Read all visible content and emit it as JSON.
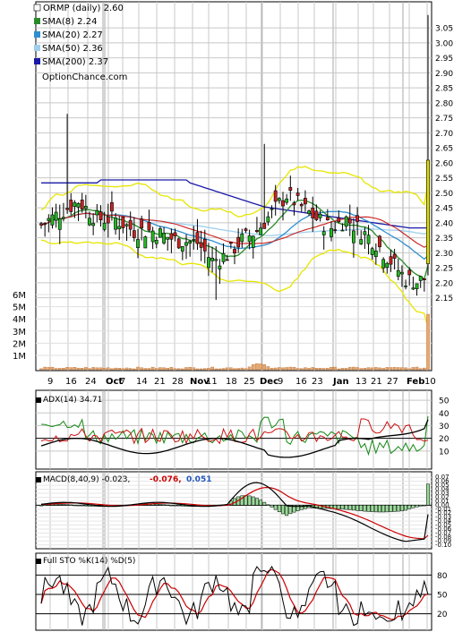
{
  "chart_data": [
    {
      "type": "candlestick",
      "panel": "price",
      "title": "ORMP (daily) 2.60",
      "watermark": "OptionChance.com",
      "legend_placement": "top-left",
      "legend": [
        {
          "label": "SMA(8) 2.24",
          "color": "#2a8a2a"
        },
        {
          "label": "SMA(20) 2.27",
          "color": "#2f8fd0"
        },
        {
          "label": "SMA(50) 2.36",
          "color": "#9fd0ee"
        },
        {
          "label": "SMA(200) 2.37",
          "color": "#1a1aa8"
        }
      ],
      "ylim": [
        2.1,
        3.1
      ],
      "y_ticks": [
        "3.05",
        "3.00",
        "2.95",
        "2.90",
        "2.85",
        "2.80",
        "2.75",
        "2.70",
        "2.65",
        "2.60",
        "2.55",
        "2.50",
        "2.45",
        "2.40",
        "2.35",
        "2.30",
        "2.25",
        "2.20",
        "2.15"
      ],
      "x_ticks": [
        "9",
        "16",
        "24",
        "Oct",
        "7",
        "14",
        "21",
        "28",
        "Nov",
        "11",
        "18",
        "25",
        "Dec",
        "9",
        "16",
        "23",
        "Jan",
        "13",
        "21",
        "27",
        "Feb",
        "10"
      ],
      "grid": true,
      "colors": {
        "up": "#22bb22",
        "down": "#cc2222",
        "bollinger": "#e6e600",
        "grid": "#c8c8c8"
      },
      "series_summary": {
        "sma8": 2.24,
        "sma20": 2.27,
        "sma50": 2.36,
        "sma200": 2.37,
        "last_close": 2.6
      }
    },
    {
      "type": "bar",
      "panel": "volume",
      "y_ticks": [
        "6M",
        "5M",
        "4M",
        "3M",
        "2M",
        "1M"
      ]
    },
    {
      "type": "line",
      "panel": "adx",
      "label": "ADX(14) 34.71",
      "ylim": [
        0,
        55
      ],
      "y_ticks": [
        "50",
        "40",
        "30",
        "20",
        "10"
      ],
      "adx_last": 34.71
    },
    {
      "type": "line",
      "panel": "macd",
      "label": "MACD(8,40,9) -0.023,",
      "signal_label": "-0.076,",
      "hist_label": "0.051",
      "signal_color": "#cc0000",
      "hist_color": "#2255bb",
      "y_ticks": [
        "0.07",
        "0.06",
        "0.05",
        "0.04",
        "0.03",
        "0.02",
        "0.01",
        "0.00",
        "-0.01",
        "-0.02",
        "-0.03",
        "-0.04",
        "-0.05",
        "-0.06",
        "-0.07",
        "-0.08",
        "-0.09",
        "-0.10"
      ]
    },
    {
      "type": "line",
      "panel": "stochastic",
      "label": "Full STO %K(14) %D(5)",
      "ylim": [
        0,
        100
      ],
      "y_ticks": [
        "80",
        "50",
        "20"
      ]
    }
  ]
}
